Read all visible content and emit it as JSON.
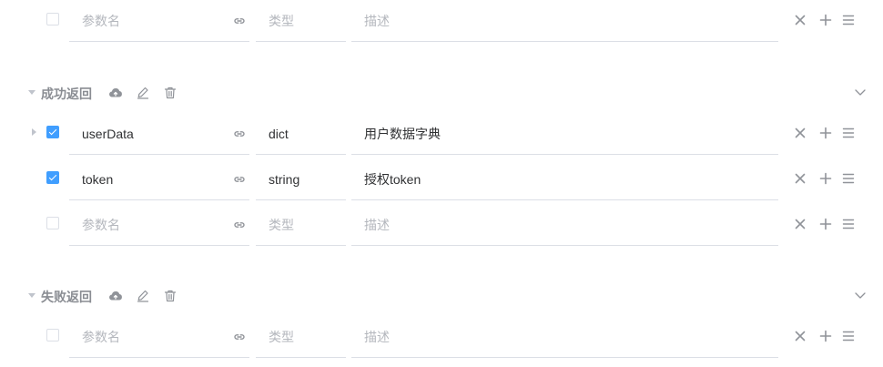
{
  "placeholders": {
    "name": "参数名",
    "type": "类型",
    "desc": "描述"
  },
  "top_row": {
    "checked": false
  },
  "sections": [
    {
      "title": "成功返回",
      "rows": [
        {
          "checked": true,
          "has_children": true,
          "name": "userData",
          "type": "dict",
          "desc": "用户数据字典"
        },
        {
          "checked": true,
          "has_children": false,
          "name": "token",
          "type": "string",
          "desc": "授权token"
        },
        {
          "checked": false,
          "has_children": false,
          "name": "",
          "type": "",
          "desc": ""
        }
      ]
    },
    {
      "title": "失败返回",
      "rows": [
        {
          "checked": false,
          "has_children": false,
          "name": "",
          "type": "",
          "desc": ""
        }
      ]
    }
  ],
  "icons": {
    "link": "link-icon",
    "delete": "close-icon",
    "add": "plus-icon",
    "drag": "menu-icon",
    "upload": "cloud-upload-icon",
    "edit": "edit-icon",
    "trash": "trash-icon",
    "collapse": "chevron-down-icon"
  },
  "colors": {
    "accent": "#409eff",
    "icon": "#909399",
    "border": "#dcdfe6",
    "placeholder": "#b4b7bd",
    "section_title": "#8a8d93"
  }
}
